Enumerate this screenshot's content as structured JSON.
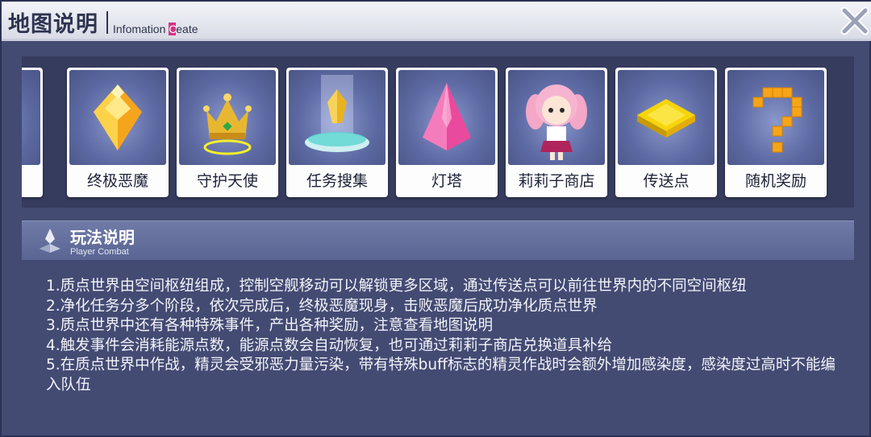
{
  "header": {
    "title": "地图说明",
    "subtitle_pre": "Infomation ",
    "subtitle_mark": "C",
    "subtitle_post": "eate"
  },
  "icons": {
    "close": "close-icon",
    "section": "compass-star-icon"
  },
  "cards": [
    {
      "label": "终极恶魔",
      "icon": "golden-pyramid-icon"
    },
    {
      "label": "守护天使",
      "icon": "crown-icon"
    },
    {
      "label": "任务搜集",
      "icon": "crystal-platform-icon"
    },
    {
      "label": "灯塔",
      "icon": "pink-crystal-icon"
    },
    {
      "label": "莉莉子商店",
      "icon": "shop-girl-icon"
    },
    {
      "label": "传送点",
      "icon": "yellow-diamond-tile-icon"
    },
    {
      "label": "随机奖励",
      "icon": "question-mark-icon"
    }
  ],
  "section": {
    "title": "玩法说明",
    "subtitle": "Player Combat"
  },
  "description": [
    "1.质点世界由空间枢纽组成，控制空舰移动可以解锁更多区域，通过传送点可以前往世界内的不同空间枢纽",
    "2.净化任务分多个阶段，依次完成后，终极恶魔现身，击败恶魔后成功净化质点世界",
    "3.质点世界中还有各种特殊事件，产出各种奖励，注意查看地图说明",
    "4.触发事件会消耗能源点数，能源点数会自动恢复，也可通过莉莉子商店兑换道具补给",
    "5.在质点世界中作战，精灵会受邪恶力量污染，带有特殊buff标志的精灵作战时会额外增加感染度，感染度过高时不能编入队伍"
  ],
  "colors": {
    "background": "#434b73",
    "header": "#e6e8ef",
    "accent": "#d63384",
    "section_bar": "#66709e"
  }
}
